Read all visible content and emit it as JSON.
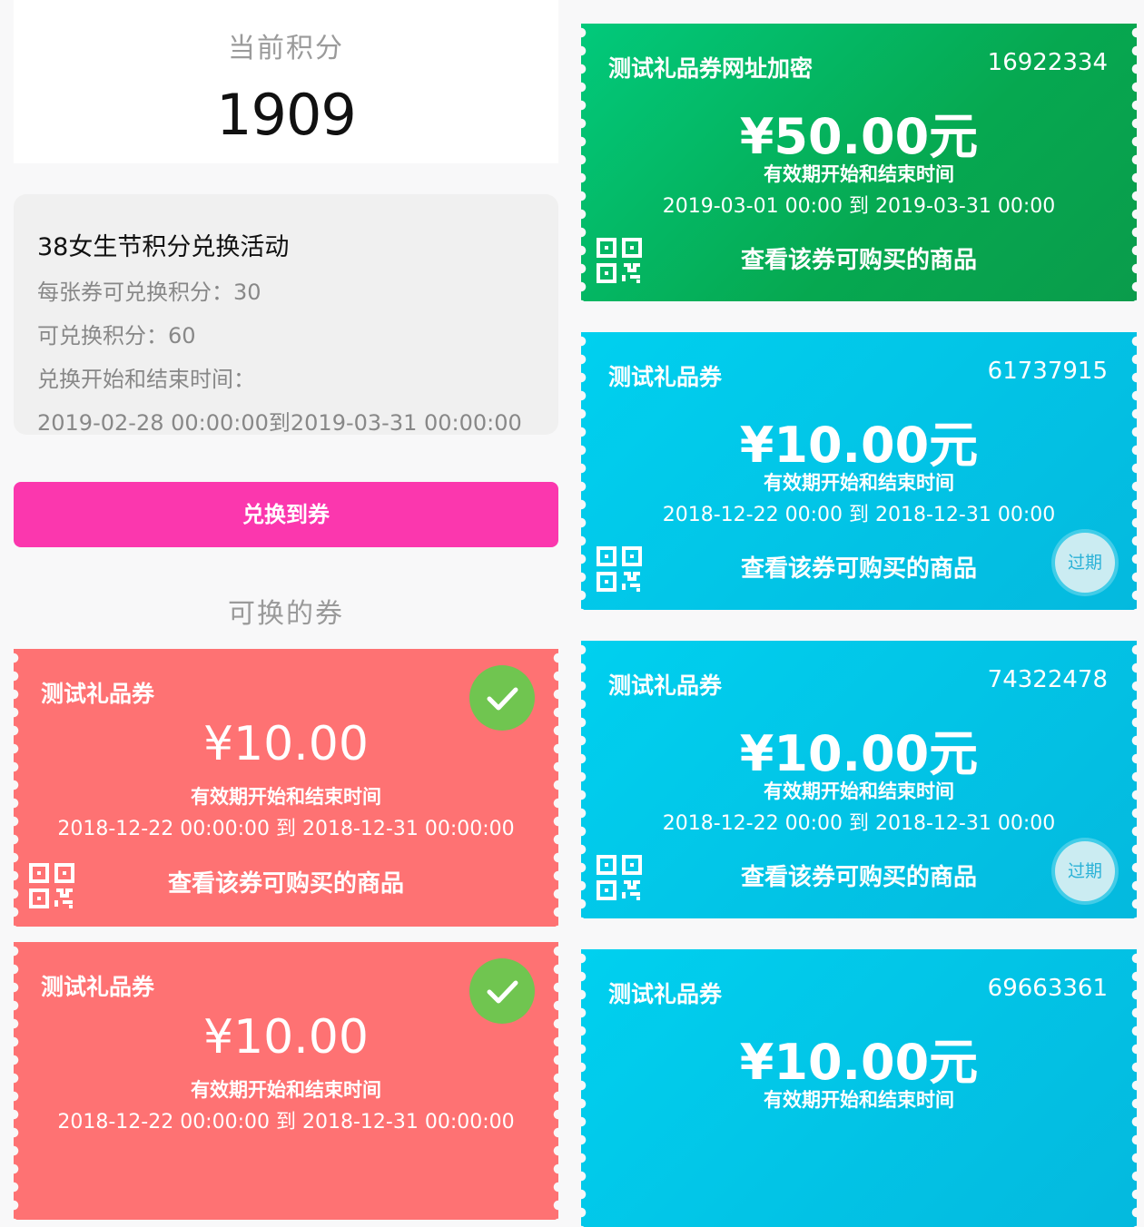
{
  "points": {
    "label": "当前积分",
    "value": "1909"
  },
  "activity": {
    "title": "38女生节积分兑换活动",
    "per_coupon": "每张券可兑换积分：30",
    "available": "可兑换积分：60",
    "time_label": "兑换开始和结束时间：",
    "time_range": "2019-02-28 00:00:00到2019-03-31 00:00:00"
  },
  "exchange_button": "兑换到券",
  "available_section_title": "可换的券",
  "colors": {
    "pink": "#fb37ae",
    "red": "#fe7273",
    "green": "#06a850",
    "blue": "#04c7e9",
    "check": "#70c550"
  },
  "left_coupons": [
    {
      "name": "测试礼品券",
      "amount": "¥10.00",
      "valid_label": "有效期开始和结束时间",
      "period": "2018-12-22 00:00:00 到 2018-12-31 00:00:00",
      "action": "查看该券可购买的商品",
      "icon": "check-icon",
      "qr_icon": "qr-code-icon"
    },
    {
      "name": "测试礼品券",
      "amount": "¥10.00",
      "valid_label": "有效期开始和结束时间",
      "period": "2018-12-22 00:00:00 到 2018-12-31 00:00:00",
      "icon": "check-icon"
    }
  ],
  "right_coupons": [
    {
      "name": "测试礼品券网址加密",
      "id": "16922334",
      "amount": "¥50.00元",
      "valid_label": "有效期开始和结束时间",
      "period": "2019-03-01 00:00 到 2019-03-31 00:00",
      "action": "查看该券可购买的商品",
      "color": "green"
    },
    {
      "name": "测试礼品券",
      "id": "61737915",
      "amount": "¥10.00元",
      "valid_label": "有效期开始和结束时间",
      "period": "2018-12-22 00:00 到 2018-12-31 00:00",
      "action": "查看该券可购买的商品",
      "badge": "过期",
      "color": "blue"
    },
    {
      "name": "测试礼品券",
      "id": "74322478",
      "amount": "¥10.00元",
      "valid_label": "有效期开始和结束时间",
      "period": "2018-12-22 00:00 到 2018-12-31 00:00",
      "action": "查看该券可购买的商品",
      "badge": "过期",
      "color": "blue"
    },
    {
      "name": "测试礼品券",
      "id": "69663361",
      "amount": "¥10.00元",
      "valid_label": "有效期开始和结束时间",
      "color": "blue"
    }
  ]
}
